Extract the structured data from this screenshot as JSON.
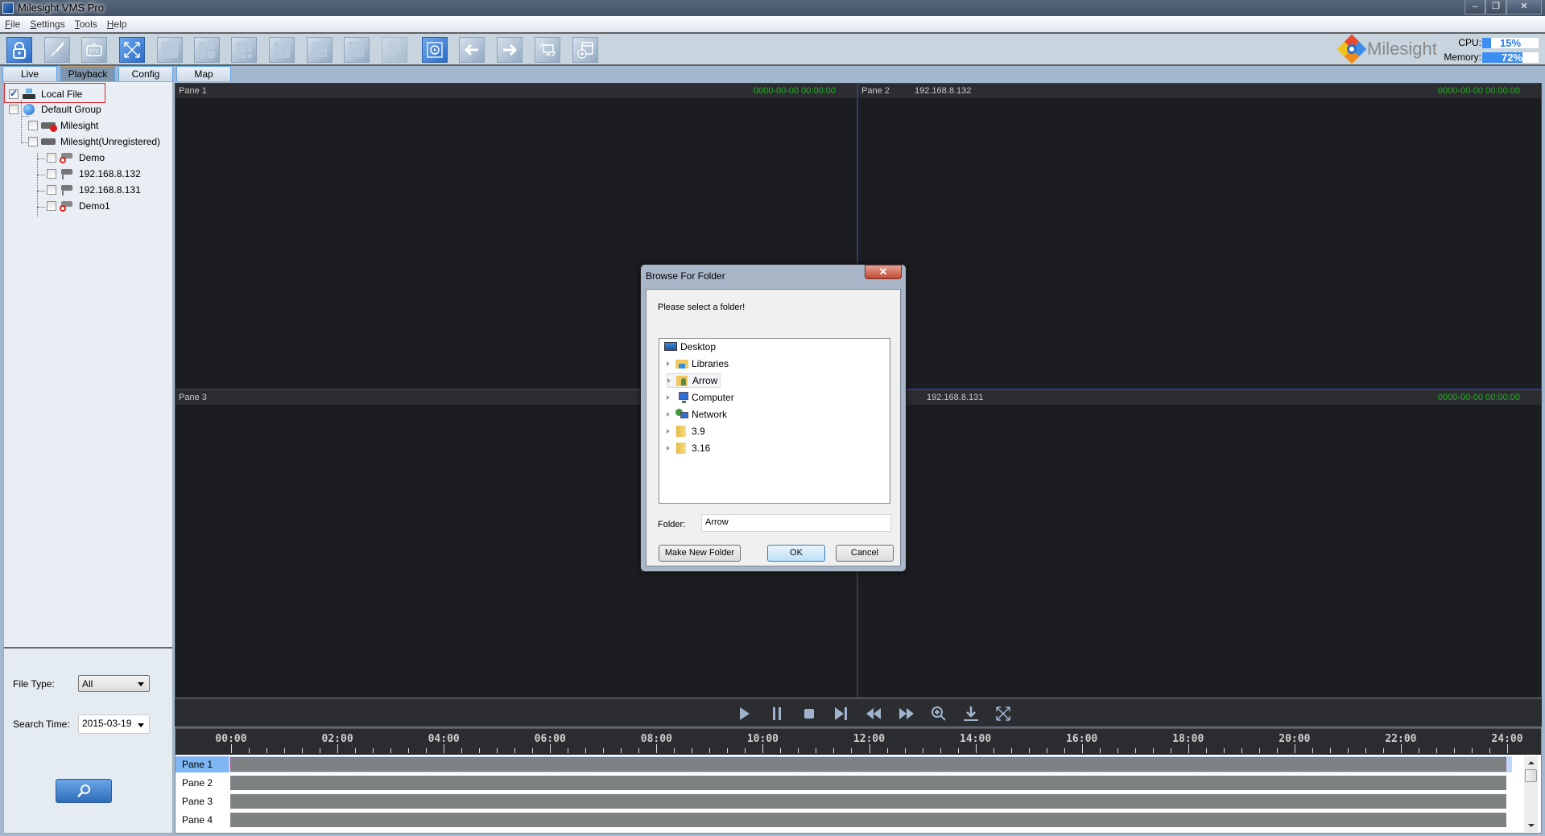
{
  "window": {
    "title": "Milesight VMS Pro",
    "controls": {
      "minimize": "–",
      "restore": "❐",
      "close": "✕"
    }
  },
  "menu": [
    {
      "label": "File",
      "accel": "F",
      "rest": "ile"
    },
    {
      "label": "Settings",
      "accel": "S",
      "rest": "ettings"
    },
    {
      "label": "Tools",
      "accel": "T",
      "rest": "ools"
    },
    {
      "label": "Help",
      "accel": "H",
      "rest": "elp"
    }
  ],
  "toolbar": {
    "buttons": [
      {
        "name": "lock",
        "active": true
      },
      {
        "name": "brush",
        "active": false
      },
      {
        "name": "ptz",
        "active": false,
        "text": "PTZ"
      },
      {
        "name": "fullscreen",
        "active": true
      },
      {
        "name": "layout-1",
        "active": false
      },
      {
        "name": "layout-4",
        "active": false
      },
      {
        "name": "layout-6",
        "active": false
      },
      {
        "name": "layout-9",
        "active": false
      },
      {
        "name": "layout-13",
        "active": false
      },
      {
        "name": "layout-16",
        "active": false
      },
      {
        "name": "layout-more",
        "active": false
      },
      {
        "name": "playback-view",
        "active": true
      },
      {
        "name": "previous",
        "active": false
      },
      {
        "name": "next",
        "active": false
      },
      {
        "name": "screen-switch",
        "active": false
      },
      {
        "name": "add-window",
        "active": false
      }
    ],
    "brand": "Milesight",
    "cpu": {
      "label": "CPU:",
      "value": "15%",
      "percent": 15
    },
    "memory": {
      "label": "Memory:",
      "value": "72%",
      "percent": 72
    }
  },
  "tabs": [
    {
      "label": "Live",
      "active": false
    },
    {
      "label": "Playback",
      "active": true
    },
    {
      "label": "Config",
      "active": false
    },
    {
      "label": "Map",
      "active": false
    }
  ],
  "sidebar": {
    "tree": [
      {
        "label": "Local File",
        "checked": true,
        "icon": "local-file-icon"
      },
      {
        "label": "Default Group",
        "checked": false,
        "icon": "globe-icon"
      },
      {
        "label": "Milesight",
        "checked": false,
        "icon": "nvr-error-icon"
      },
      {
        "label": "Milesight(Unregistered)",
        "checked": false,
        "icon": "nvr-icon"
      },
      {
        "label": "Demo",
        "checked": false,
        "icon": "camera-offline-icon"
      },
      {
        "label": "192.168.8.132",
        "checked": false,
        "icon": "camera-icon"
      },
      {
        "label": "192.168.8.131",
        "checked": false,
        "icon": "camera-icon"
      },
      {
        "label": "Demo1",
        "checked": false,
        "icon": "camera-offline-icon"
      }
    ],
    "file_type_label": "File Type:",
    "file_type_value": "All",
    "search_time_label": "Search Time:",
    "search_time_value": "2015-03-19"
  },
  "panes": [
    {
      "label": "Pane 1",
      "ip": "",
      "timestamp": "0000-00-00 00:00:00"
    },
    {
      "label": "Pane 2",
      "ip": "192.168.8.132",
      "timestamp": "0000-00-00 00:00:00"
    },
    {
      "label": "Pane 3",
      "ip": "",
      "timestamp": ""
    },
    {
      "label": "",
      "ip": "192.168.8.131",
      "timestamp": "0000-00-00 00:00:00"
    }
  ],
  "playback_controls": [
    "play",
    "pause",
    "stop",
    "next-frame",
    "rewind",
    "fast-forward",
    "zoom-in",
    "download",
    "fullscreen"
  ],
  "timeline": {
    "hour_labels": [
      "00:00",
      "02:00",
      "04:00",
      "06:00",
      "08:00",
      "10:00",
      "12:00",
      "14:00",
      "16:00",
      "18:00",
      "20:00",
      "22:00",
      "24:00"
    ],
    "rows": [
      {
        "label": "Pane 1",
        "selected": true
      },
      {
        "label": "Pane 2",
        "selected": false
      },
      {
        "label": "Pane 3",
        "selected": false
      },
      {
        "label": "Pane 4",
        "selected": false
      }
    ]
  },
  "dialog": {
    "title": "Browse For Folder",
    "close": "✕",
    "prompt": "Please select a folder!",
    "items": [
      {
        "label": "Desktop",
        "expandable": false,
        "selected": false,
        "icon": "desktop-icon"
      },
      {
        "label": "Libraries",
        "expandable": true,
        "selected": false,
        "icon": "libraries-icon"
      },
      {
        "label": "Arrow",
        "expandable": true,
        "selected": true,
        "icon": "user-folder-icon"
      },
      {
        "label": "Computer",
        "expandable": true,
        "selected": false,
        "icon": "computer-icon"
      },
      {
        "label": "Network",
        "expandable": true,
        "selected": false,
        "icon": "network-icon"
      },
      {
        "label": "3.9",
        "expandable": true,
        "selected": false,
        "icon": "folder-icon"
      },
      {
        "label": "3.16",
        "expandable": true,
        "selected": false,
        "icon": "folder-icon"
      }
    ],
    "folder_label": "Folder:",
    "folder_value": "Arrow",
    "buttons": {
      "new_folder": "Make New Folder",
      "ok": "OK",
      "cancel": "Cancel"
    }
  },
  "colors": {
    "accent": "#3d8ef2",
    "timestamp": "#22b022",
    "selected_pane": "#2a3ac8",
    "highlight_box": "#e0262c"
  }
}
